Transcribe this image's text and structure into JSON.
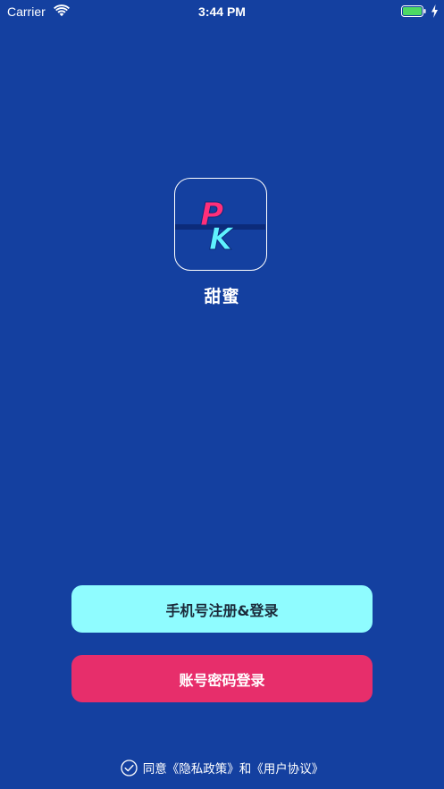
{
  "status_bar": {
    "carrier": "Carrier",
    "time": "3:44 PM",
    "battery_color": "#4cd964"
  },
  "app": {
    "logo_text_top": "P",
    "logo_text_bottom": "K",
    "name": "甜蜜"
  },
  "buttons": {
    "phone_login": "手机号注册&登录",
    "account_login": "账号密码登录"
  },
  "agreement": {
    "prefix": "同意",
    "privacy_policy": "《隐私政策》",
    "conjunction": "和",
    "user_agreement": "《用户协议》",
    "checked": true
  },
  "colors": {
    "background": "#1440a0",
    "primary_button": "#8ffcff",
    "secondary_button": "#e72e6b",
    "logo_pink": "#ff2f7a",
    "logo_cyan": "#5ff2ff"
  }
}
